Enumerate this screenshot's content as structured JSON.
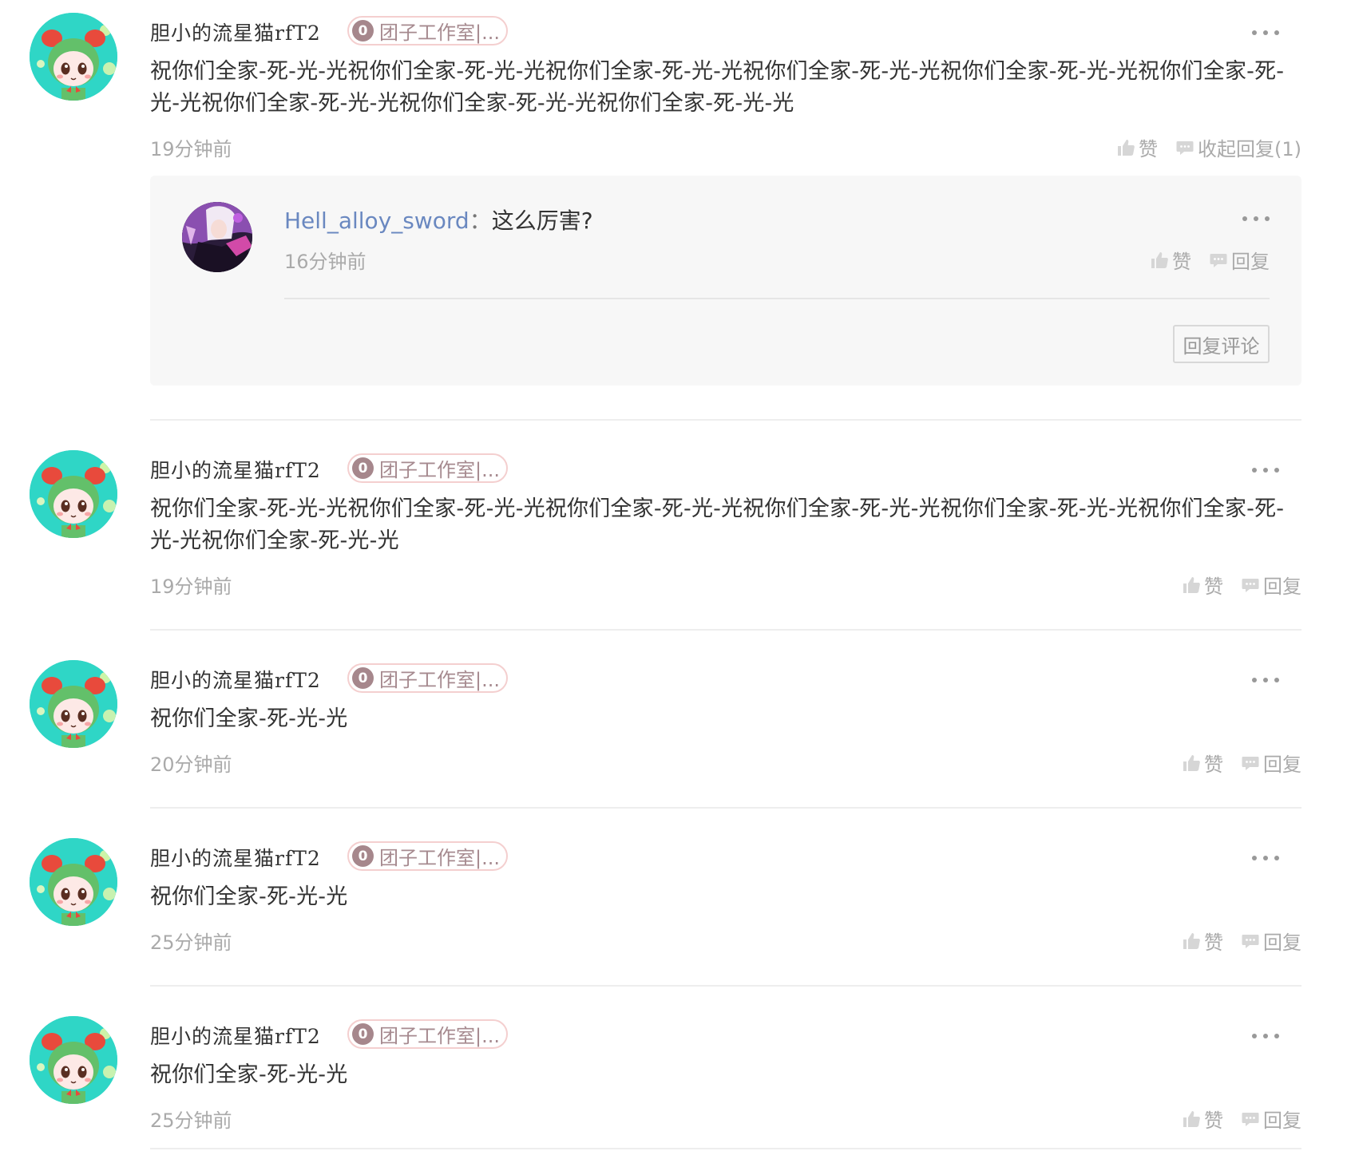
{
  "comments": [
    {
      "username": "胆小的流星猫rfT2",
      "badge_level": "0",
      "badge_name": "团子工作室|...",
      "text": "祝你们全家-死-光-光祝你们全家-死-光-光祝你们全家-死-光-光祝你们全家-死-光-光祝你们全家-死-光-光祝你们全家-死-光-光祝你们全家-死-光-光祝你们全家-死-光-光祝你们全家-死-光-光",
      "time": "19分钟前",
      "like_label": "赞",
      "reply_label": "收起回复(1)",
      "replies": [
        {
          "username": "Hell_alloy_sword",
          "separator": "：",
          "text": "这么厉害?",
          "time": "16分钟前",
          "like_label": "赞",
          "reply_label": "回复"
        }
      ],
      "reply_comment_button": "回复评论"
    },
    {
      "username": "胆小的流星猫rfT2",
      "badge_level": "0",
      "badge_name": "团子工作室|...",
      "text": "祝你们全家-死-光-光祝你们全家-死-光-光祝你们全家-死-光-光祝你们全家-死-光-光祝你们全家-死-光-光祝你们全家-死-光-光祝你们全家-死-光-光",
      "time": "19分钟前",
      "like_label": "赞",
      "reply_label": "回复"
    },
    {
      "username": "胆小的流星猫rfT2",
      "badge_level": "0",
      "badge_name": "团子工作室|...",
      "text": "祝你们全家-死-光-光",
      "time": "20分钟前",
      "like_label": "赞",
      "reply_label": "回复"
    },
    {
      "username": "胆小的流星猫rfT2",
      "badge_level": "0",
      "badge_name": "团子工作室|...",
      "text": "祝你们全家-死-光-光",
      "time": "25分钟前",
      "like_label": "赞",
      "reply_label": "回复"
    },
    {
      "username": "胆小的流星猫rfT2",
      "badge_level": "0",
      "badge_name": "团子工作室|...",
      "text": "祝你们全家-死-光-光",
      "time": "25分钟前",
      "like_label": "赞",
      "reply_label": "回复"
    }
  ],
  "icons": {
    "like": "thumbs-up-icon",
    "reply": "speech-bubble-icon",
    "more": "more-dots-icon"
  },
  "colors": {
    "reply_username": "#6a88c0",
    "badge_border": "#f4cfcf",
    "badge_level_bg": "#a6878c",
    "muted_text": "#aaaaaa"
  }
}
